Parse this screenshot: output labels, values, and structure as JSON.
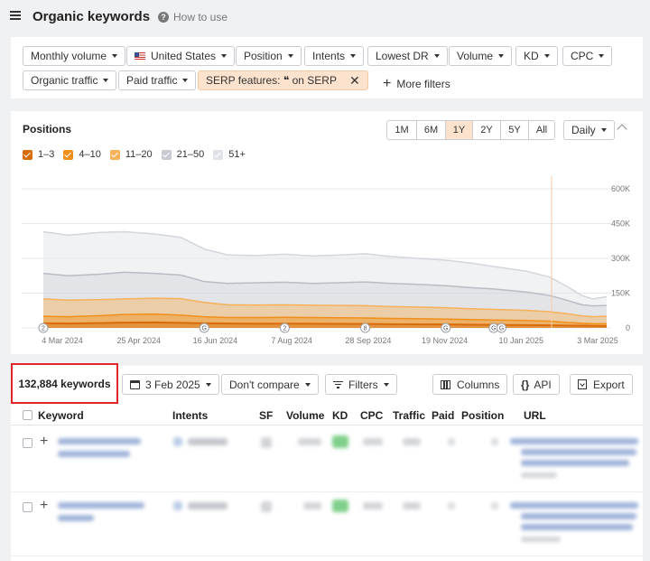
{
  "header": {
    "title": "Organic keywords",
    "how_to": "How to use"
  },
  "filters": {
    "monthly_volume": "Monthly volume",
    "country": "United States",
    "position": "Position",
    "intents": "Intents",
    "lowest_dr": "Lowest DR",
    "volume": "Volume",
    "kd": "KD",
    "cpc": "CPC",
    "organic_traffic": "Organic traffic",
    "paid_traffic": "Paid traffic",
    "serp_features": "SERP features: ❝ on SERP",
    "more_filters": "More filters"
  },
  "positions": {
    "title": "Positions",
    "ranges": [
      "1M",
      "6M",
      "1Y",
      "2Y",
      "5Y",
      "All"
    ],
    "active_range": "1Y",
    "interval": "Daily",
    "legend": [
      {
        "label": "1–3",
        "color": "#d86c0a",
        "checked": true
      },
      {
        "label": "4–10",
        "color": "#f0901a",
        "checked": true
      },
      {
        "label": "11–20",
        "color": "#f6b15a",
        "checked": true
      },
      {
        "label": "21–50",
        "color": "#c7cbd1",
        "checked": true
      },
      {
        "label": "51+",
        "color": "#dfe2e6",
        "checked": true
      }
    ]
  },
  "chart_data": {
    "type": "area",
    "x_tick_labels": [
      "4 Mar 2024",
      "25 Apr 2024",
      "16 Jun 2024",
      "7 Aug 2024",
      "28 Sep 2024",
      "19 Nov 2024",
      "10 Jan 2025",
      "3 Mar 2025"
    ],
    "y_tick_labels": [
      "600K",
      "450K",
      "300K",
      "150K",
      "0"
    ],
    "ylim": [
      0,
      600000
    ],
    "x": [
      "2024-03-04",
      "2024-03-20",
      "2024-04-10",
      "2024-04-25",
      "2024-05-15",
      "2024-06-01",
      "2024-06-16",
      "2024-07-01",
      "2024-07-20",
      "2024-08-07",
      "2024-08-25",
      "2024-09-10",
      "2024-09-28",
      "2024-10-15",
      "2024-11-01",
      "2024-11-19",
      "2024-12-05",
      "2024-12-20",
      "2025-01-10",
      "2025-01-25",
      "2025-02-05",
      "2025-02-15",
      "2025-02-22",
      "2025-03-03"
    ],
    "series": [
      {
        "name": "1–3",
        "color": "#d86c0a",
        "values": [
          20000,
          19000,
          21000,
          23000,
          24000,
          22000,
          20000,
          19000,
          18000,
          18500,
          18000,
          17500,
          17000,
          16000,
          15500,
          15000,
          14000,
          13000,
          12000,
          11000,
          10000,
          9500,
          9000,
          8500
        ]
      },
      {
        "name": "4–10",
        "color": "#f0901a",
        "values": [
          50000,
          48000,
          53000,
          58000,
          60000,
          55000,
          48000,
          45000,
          45000,
          46000,
          45000,
          44000,
          43000,
          41000,
          40000,
          38000,
          36000,
          34000,
          32000,
          29000,
          24000,
          20000,
          18000,
          18000
        ]
      },
      {
        "name": "11–20",
        "color": "#f6b15a",
        "values": [
          125000,
          120000,
          122000,
          125000,
          128000,
          126000,
          110000,
          100000,
          99000,
          100000,
          98000,
          97000,
          96000,
          92000,
          90000,
          87000,
          83000,
          80000,
          76000,
          70000,
          62000,
          52000,
          48000,
          50000
        ]
      },
      {
        "name": "21–50",
        "color": "#c7cbd1",
        "values": [
          235000,
          225000,
          232000,
          240000,
          235000,
          228000,
          200000,
          192000,
          195000,
          197000,
          192000,
          195000,
          198000,
          192000,
          188000,
          182000,
          174000,
          168000,
          155000,
          140000,
          120000,
          100000,
          95000,
          97000
        ]
      },
      {
        "name": "51+",
        "color": "#dfe2e6",
        "values": [
          415000,
          400000,
          412000,
          415000,
          405000,
          390000,
          340000,
          315000,
          312000,
          318000,
          310000,
          314000,
          320000,
          308000,
          300000,
          292000,
          280000,
          265000,
          245000,
          220000,
          180000,
          140000,
          125000,
          135000
        ]
      }
    ],
    "annotations": [
      {
        "x": "2024-03-04",
        "label": "2"
      },
      {
        "x": "2024-06-16",
        "label": "G"
      },
      {
        "x": "2024-08-07",
        "label": "2"
      },
      {
        "x": "2024-09-28",
        "label": "8"
      },
      {
        "x": "2024-11-19",
        "label": "G"
      },
      {
        "x": "2024-12-20",
        "label": "G"
      },
      {
        "x": "2024-12-25",
        "label": "G"
      }
    ],
    "grid": true
  },
  "keywords": {
    "count": "132,884 keywords",
    "date": "3 Feb 2025",
    "compare": "Don't compare",
    "filters": "Filters",
    "columns": "Columns",
    "api": "API",
    "export": "Export",
    "headers": [
      "Keyword",
      "Intents",
      "SF",
      "Volume",
      "KD",
      "CPC",
      "Traffic",
      "Paid",
      "Position",
      "URL"
    ]
  }
}
